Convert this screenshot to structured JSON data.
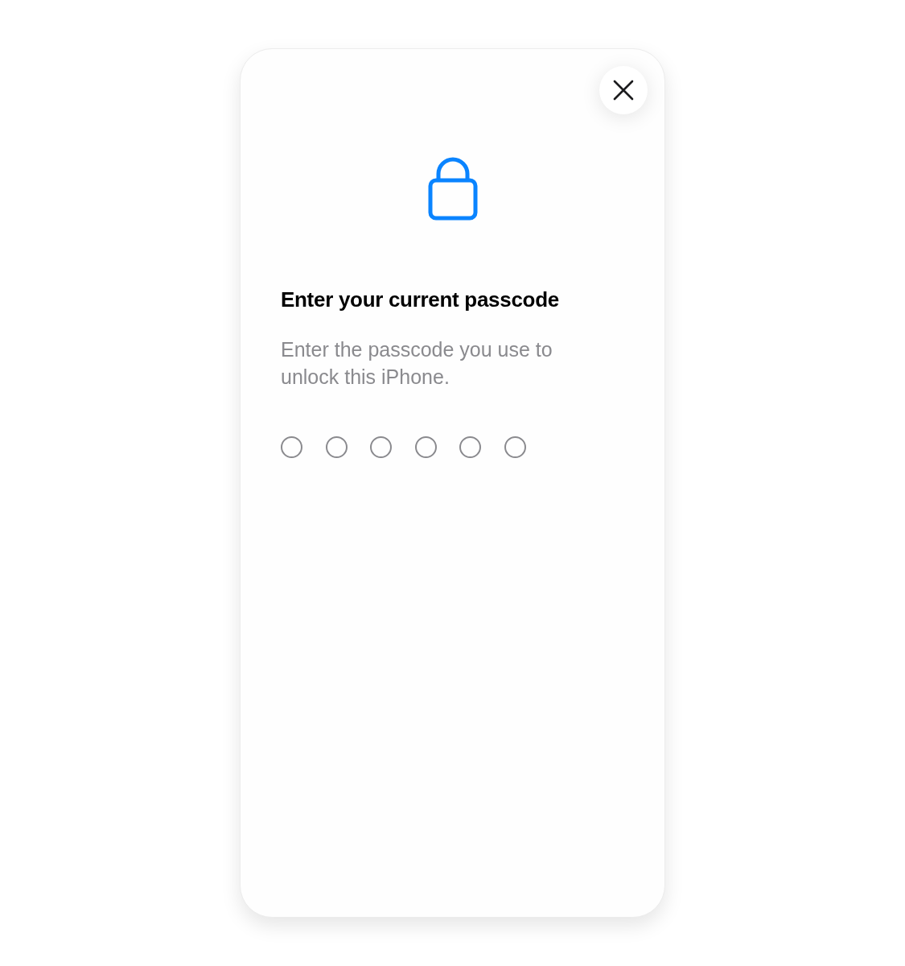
{
  "title": "Enter your current passcode",
  "subtitle": "Enter the passcode you use to unlock this iPhone.",
  "passcode_dots": [
    {
      "filled": false
    },
    {
      "filled": false
    },
    {
      "filled": false
    },
    {
      "filled": false
    },
    {
      "filled": false
    },
    {
      "filled": false
    }
  ]
}
